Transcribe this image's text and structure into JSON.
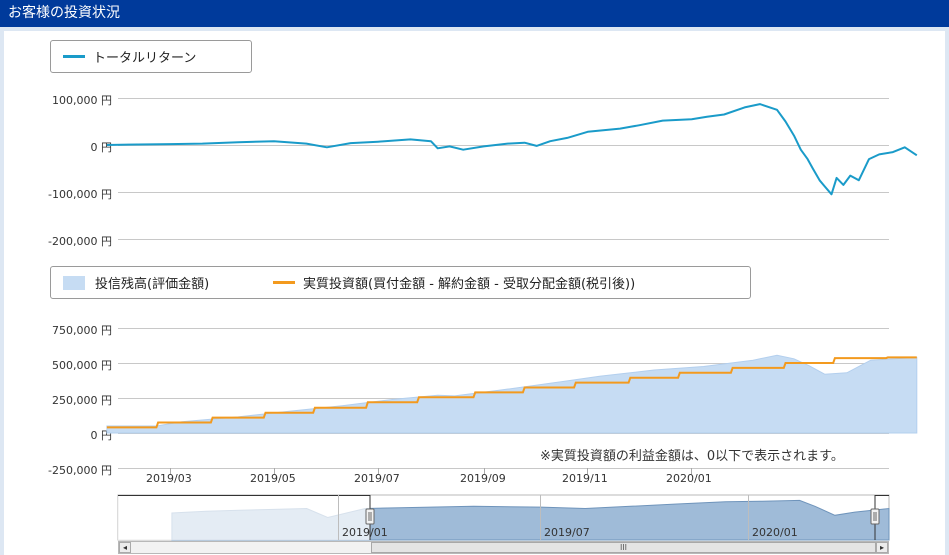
{
  "header": {
    "title": "お客様の投資状況"
  },
  "chart_data": [
    {
      "type": "line",
      "legend": [
        "トータルリターン"
      ],
      "y_ticks": [
        "100,000 円",
        "0 円",
        "-100,000 円",
        "-200,000 円"
      ],
      "ylim": [
        -200000,
        100000
      ],
      "series": [
        {
          "name": "トータルリターン",
          "color": "#1a9bc9",
          "x": [
            "2019-01-23",
            "2019-02-10",
            "2019-03-01",
            "2019-03-20",
            "2019-04-10",
            "2019-05-01",
            "2019-05-20",
            "2019-06-01",
            "2019-06-15",
            "2019-07-01",
            "2019-07-20",
            "2019-08-01",
            "2019-08-05",
            "2019-08-12",
            "2019-08-20",
            "2019-09-01",
            "2019-09-15",
            "2019-09-25",
            "2019-10-02",
            "2019-10-10",
            "2019-10-20",
            "2019-11-01",
            "2019-11-20",
            "2019-12-01",
            "2019-12-15",
            "2020-01-01",
            "2020-01-10",
            "2020-01-20",
            "2020-02-01",
            "2020-02-10",
            "2020-02-20",
            "2020-02-25",
            "2020-03-01",
            "2020-03-05",
            "2020-03-09",
            "2020-03-12",
            "2020-03-16",
            "2020-03-19",
            "2020-03-23",
            "2020-03-26",
            "2020-03-30",
            "2020-04-03",
            "2020-04-08",
            "2020-04-14",
            "2020-04-20",
            "2020-04-28",
            "2020-05-05",
            "2020-05-12"
          ],
          "values": [
            0,
            1000,
            2000,
            3000,
            6000,
            8000,
            3000,
            -5000,
            4000,
            7000,
            12000,
            8000,
            -7000,
            -3000,
            -10000,
            -3000,
            3000,
            5000,
            -2000,
            8000,
            15000,
            28000,
            35000,
            42000,
            52000,
            55000,
            60000,
            65000,
            80000,
            87000,
            75000,
            50000,
            20000,
            -10000,
            -30000,
            -50000,
            -75000,
            -88000,
            -105000,
            -70000,
            -85000,
            -65000,
            -75000,
            -30000,
            -20000,
            -15000,
            -5000,
            -22000
          ]
        }
      ]
    },
    {
      "type": "area",
      "legend": [
        "投信残高(評価金額)",
        "実質投資額(買付金額 - 解約金額 - 受取分配金額(税引後))"
      ],
      "y_ticks": [
        "750,000 円",
        "500,000 円",
        "250,000 円",
        "0 円",
        "-250,000 円"
      ],
      "ylim": [
        -250000,
        750000
      ],
      "x_ticks": [
        "2019/03",
        "2019/05",
        "2019/07",
        "2019/09",
        "2019/11",
        "2020/01"
      ],
      "note": "※実質投資額の利益金額は、0以下で表示されます。",
      "series": [
        {
          "name": "投信残高(評価金額)",
          "color": "#c6dcf3",
          "x": [
            "2019-01-23",
            "2019-02-21",
            "2019-03-08",
            "2019-04-10",
            "2019-05-10",
            "2019-06-10",
            "2019-07-10",
            "2019-08-05",
            "2019-08-15",
            "2019-09-10",
            "2019-10-10",
            "2019-11-08",
            "2019-12-10",
            "2020-01-08",
            "2020-02-06",
            "2020-02-20",
            "2020-03-01",
            "2020-03-10",
            "2020-03-19",
            "2020-04-01",
            "2020-04-15",
            "2020-05-12"
          ],
          "values": [
            50000,
            50000,
            80000,
            115000,
            155000,
            195000,
            240000,
            270000,
            265000,
            305000,
            355000,
            405000,
            450000,
            475000,
            520000,
            555000,
            530000,
            480000,
            420000,
            430000,
            520000,
            540000
          ]
        },
        {
          "name": "実質投資額(買付金額 - 解約金額 - 受取分配金額(税引後))",
          "color": "#f39a1e",
          "x": [
            "2019-01-23",
            "2019-02-21",
            "2019-02-22",
            "2019-03-25",
            "2019-03-26",
            "2019-04-25",
            "2019-04-26",
            "2019-05-24",
            "2019-05-25",
            "2019-06-24",
            "2019-06-25",
            "2019-07-24",
            "2019-07-25",
            "2019-08-26",
            "2019-08-27",
            "2019-09-24",
            "2019-09-25",
            "2019-10-24",
            "2019-10-25",
            "2019-11-25",
            "2019-11-26",
            "2019-12-24",
            "2019-12-25",
            "2020-01-24",
            "2020-01-25",
            "2020-02-24",
            "2020-02-25",
            "2020-03-24",
            "2020-03-25",
            "2020-04-24",
            "2020-04-25",
            "2020-05-12"
          ],
          "values": [
            40000,
            40000,
            75000,
            75000,
            110000,
            110000,
            145000,
            145000,
            180000,
            180000,
            220000,
            220000,
            255000,
            255000,
            290000,
            290000,
            325000,
            325000,
            360000,
            360000,
            395000,
            395000,
            430000,
            430000,
            465000,
            465000,
            500000,
            500000,
            535000,
            535000,
            540000,
            540000
          ]
        }
      ]
    },
    {
      "type": "area",
      "role": "navigator",
      "x_ticks": [
        "2019/01",
        "2019/07",
        "2020/01"
      ],
      "series": [
        {
          "color": "#6f94bb",
          "x": [
            "2018-08-01",
            "2018-09-01",
            "2018-10-01",
            "2018-11-01",
            "2018-12-01",
            "2018-12-20",
            "2019-01-23",
            "2019-03-01",
            "2019-05-01",
            "2019-07-01",
            "2019-08-10",
            "2019-09-20",
            "2019-11-01",
            "2019-12-15",
            "2020-01-15",
            "2020-02-20",
            "2020-03-05",
            "2020-03-23",
            "2020-04-10",
            "2020-05-12"
          ],
          "values": [
            60,
            64,
            66,
            68,
            70,
            50,
            70,
            72,
            75,
            73,
            70,
            75,
            80,
            85,
            86,
            88,
            75,
            55,
            62,
            70
          ]
        }
      ]
    }
  ],
  "scrollbar": {
    "left_arrow": "◂",
    "thumb": "III",
    "right_arrow": "▸"
  }
}
